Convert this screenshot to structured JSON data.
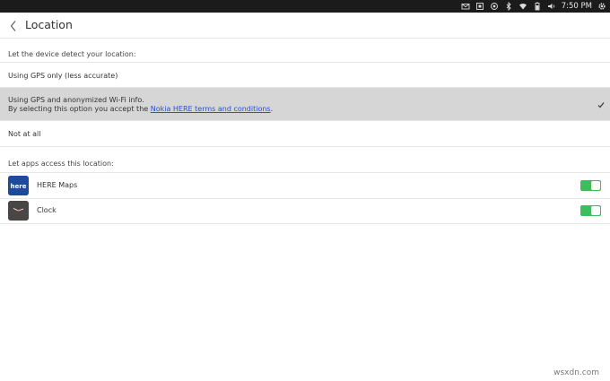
{
  "statusbar": {
    "time": "7:50 PM",
    "icons": [
      "mail-icon",
      "scan-icon",
      "location-icon",
      "bluetooth-icon",
      "wifi-icon",
      "battery-icon",
      "volume-icon",
      "gear-icon"
    ]
  },
  "header": {
    "title": "Location"
  },
  "detect_section": {
    "label": "Let the device detect your location:",
    "options": [
      {
        "label": "Using GPS only (less accurate)"
      },
      {
        "line1": "Using GPS and anonymized Wi-Fi info.",
        "line2_prefix": "By selecting this option you accept the ",
        "link": "Nokia HERE terms and conditions",
        "line2_suffix": ".",
        "selected": true
      },
      {
        "label": "Not at all"
      }
    ]
  },
  "apps_section": {
    "label": "Let apps access this location:",
    "apps": [
      {
        "name": "HERE Maps",
        "icon": "here-maps-icon",
        "icon_text": "here",
        "enabled": true
      },
      {
        "name": "Clock",
        "icon": "clock-icon",
        "enabled": true
      }
    ]
  },
  "watermark": "wsxdn.com",
  "colors": {
    "statusbar": "#1b1b1b",
    "selected_row": "#d6d6d6",
    "toggle_on": "#3dbd5c",
    "link": "#2a4fd6",
    "here_blue": "#1d4a9c"
  }
}
